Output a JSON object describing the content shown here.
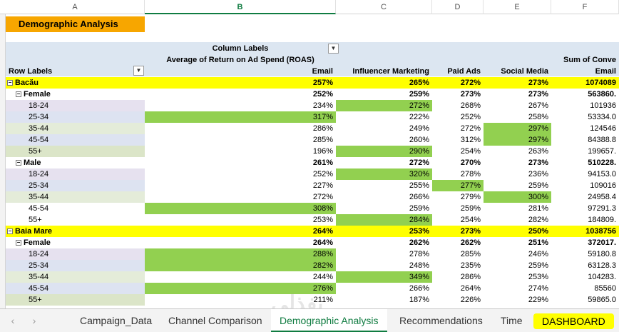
{
  "columns": [
    "A",
    "B",
    "C",
    "D",
    "E",
    "F"
  ],
  "selected_column": "B",
  "row_numbers": [
    "",
    "",
    "",
    "",
    "",
    "",
    "",
    "",
    "",
    "",
    "",
    "",
    "",
    "",
    "",
    "",
    "",
    "",
    "",
    "",
    "",
    "",
    "",
    "",
    "",
    ""
  ],
  "title": "Demographic Analysis",
  "headers": {
    "column_labels": "Column Labels",
    "avg_roas": "Average of Return on Ad Spend (ROAS)",
    "sum_conv": "Sum of Conve",
    "row_labels": "Row Labels",
    "email": "Email",
    "influencer": "Influencer Marketing",
    "paid": "Paid Ads",
    "social": "Social Media",
    "email2": "Email"
  },
  "rows": [
    {
      "label": "Bacău",
      "level": 0,
      "toggle": "⊟",
      "vals": [
        "257%",
        "265%",
        "272%",
        "273%",
        "1074089"
      ],
      "kind": "city"
    },
    {
      "label": "Female",
      "level": 1,
      "toggle": "⊟",
      "vals": [
        "252%",
        "259%",
        "273%",
        "273%",
        "563860."
      ],
      "kind": "gender"
    },
    {
      "label": "18-24",
      "level": 2,
      "vals": [
        "234%",
        "272%",
        "268%",
        "267%",
        "101936"
      ],
      "kind": "age",
      "bg": "lav",
      "hl": [
        1
      ]
    },
    {
      "label": "25-34",
      "level": 2,
      "vals": [
        "317%",
        "222%",
        "252%",
        "258%",
        "53334.0"
      ],
      "kind": "age",
      "bg": "lblue",
      "hl": [
        0
      ]
    },
    {
      "label": "35-44",
      "level": 2,
      "vals": [
        "286%",
        "249%",
        "272%",
        "297%",
        "124546"
      ],
      "kind": "age",
      "bg": "lgreen",
      "hl": [
        3
      ]
    },
    {
      "label": "45-54",
      "level": 2,
      "vals": [
        "285%",
        "260%",
        "312%",
        "297%",
        "84388.8"
      ],
      "kind": "age",
      "bg": "lblue",
      "hl": [
        3
      ]
    },
    {
      "label": "55+",
      "level": 2,
      "vals": [
        "196%",
        "290%",
        "254%",
        "263%",
        "199657."
      ],
      "kind": "age",
      "bg": "sage",
      "hl": [
        1
      ]
    },
    {
      "label": "Male",
      "level": 1,
      "toggle": "⊟",
      "vals": [
        "261%",
        "272%",
        "270%",
        "273%",
        "510228."
      ],
      "kind": "gender"
    },
    {
      "label": "18-24",
      "level": 2,
      "vals": [
        "252%",
        "320%",
        "278%",
        "236%",
        "94153.0"
      ],
      "kind": "age",
      "bg": "lav",
      "hl": [
        1
      ]
    },
    {
      "label": "25-34",
      "level": 2,
      "vals": [
        "227%",
        "255%",
        "277%",
        "259%",
        "109016"
      ],
      "kind": "age",
      "bg": "lblue",
      "hl": [
        2
      ]
    },
    {
      "label": "35-44",
      "level": 2,
      "vals": [
        "272%",
        "266%",
        "279%",
        "300%",
        "24958.4"
      ],
      "kind": "age",
      "bg": "lgreen",
      "hl": [
        3
      ]
    },
    {
      "label": "45-54",
      "level": 2,
      "vals": [
        "308%",
        "259%",
        "259%",
        "281%",
        "97291.3"
      ],
      "kind": "age",
      "bg": "white",
      "hl": [
        0
      ]
    },
    {
      "label": "55+",
      "level": 2,
      "vals": [
        "253%",
        "284%",
        "254%",
        "282%",
        "184809."
      ],
      "kind": "age",
      "bg": "white",
      "hl": [
        1
      ]
    },
    {
      "label": "Baia Mare",
      "level": 0,
      "toggle": "⊟",
      "vals": [
        "264%",
        "253%",
        "273%",
        "250%",
        "1038756"
      ],
      "kind": "city"
    },
    {
      "label": "Female",
      "level": 1,
      "toggle": "⊟",
      "vals": [
        "264%",
        "262%",
        "262%",
        "251%",
        "372017."
      ],
      "kind": "gender"
    },
    {
      "label": "18-24",
      "level": 2,
      "vals": [
        "288%",
        "278%",
        "285%",
        "246%",
        "59180.8"
      ],
      "kind": "age",
      "bg": "lav",
      "hl": [
        0
      ]
    },
    {
      "label": "25-34",
      "level": 2,
      "vals": [
        "282%",
        "248%",
        "235%",
        "259%",
        "63128.3"
      ],
      "kind": "age",
      "bg": "lblue",
      "hl": [
        0
      ]
    },
    {
      "label": "35-44",
      "level": 2,
      "vals": [
        "244%",
        "349%",
        "286%",
        "253%",
        "104283."
      ],
      "kind": "age",
      "bg": "lgreen",
      "hl": [
        1
      ]
    },
    {
      "label": "45-54",
      "level": 2,
      "vals": [
        "276%",
        "266%",
        "264%",
        "274%",
        "85560"
      ],
      "kind": "age",
      "bg": "lblue",
      "hl": [
        0
      ]
    },
    {
      "label": "55+",
      "level": 2,
      "vals": [
        "211%",
        "187%",
        "226%",
        "229%",
        "59865.0"
      ],
      "kind": "age",
      "bg": "sage",
      "hl": []
    }
  ],
  "tabs": {
    "prev_icon": "‹",
    "next_icon": "›",
    "items": [
      "Campaign_Data",
      "Channel Comparison",
      "Demographic Analysis",
      "Recommendations",
      "Time",
      "DASHBOARD"
    ],
    "active": "Demographic Analysis"
  },
  "colors": {
    "title_bg": "#f7a600",
    "highlight": "#92d050",
    "city_row": "#ffff00",
    "header_band": "#dce6f1",
    "active_tab": "#107c41"
  }
}
